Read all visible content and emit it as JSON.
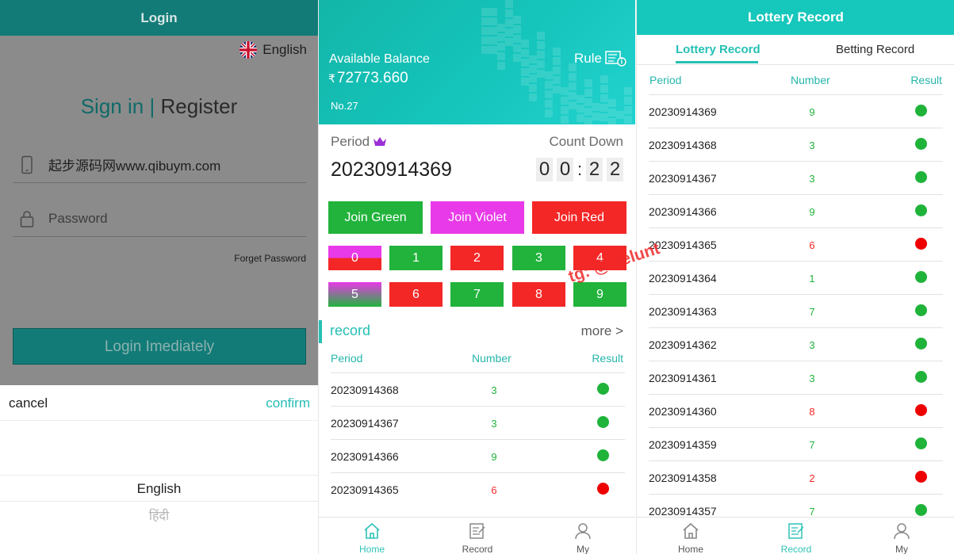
{
  "login": {
    "title": "Login",
    "language": "English",
    "sign_in": "Sign in",
    "separator": "|",
    "register": "Register",
    "phone_value": "起步源码网www.qibuym.com",
    "password_placeholder": "Password",
    "forget_password": "Forget Password",
    "login_button": "Login Imediately",
    "picker": {
      "cancel": "cancel",
      "confirm": "confirm",
      "options": [
        "English",
        "हिंदी"
      ]
    }
  },
  "home": {
    "balance_label": "Available Balance",
    "currency": "₹",
    "balance_value": "72773.660",
    "rule_label": "Rule",
    "banner_number": "No.27",
    "period_label": "Period",
    "countdown_label": "Count Down",
    "period_value": "20230914369",
    "countdown_digits": [
      "0",
      "0",
      "2",
      "2"
    ],
    "countdown_separator": ":",
    "join_buttons": [
      {
        "label": "Join Green",
        "color": "#21b33c"
      },
      {
        "label": "Join Violet",
        "color": "#e83ae8"
      },
      {
        "label": "Join Red",
        "color": "#f42727"
      }
    ],
    "numbers": [
      "0",
      "1",
      "2",
      "3",
      "4",
      "5",
      "6",
      "7",
      "8",
      "9"
    ],
    "record_title": "record",
    "more": "more >",
    "table_headers": [
      "Period",
      "Number",
      "Result"
    ],
    "records": [
      {
        "period": "20230914368",
        "number": "3",
        "result": "green"
      },
      {
        "period": "20230914367",
        "number": "3",
        "result": "green"
      },
      {
        "period": "20230914366",
        "number": "9",
        "result": "green"
      },
      {
        "period": "20230914365",
        "number": "6",
        "result": "red"
      }
    ]
  },
  "lottery": {
    "title": "Lottery Record",
    "tabs": [
      "Lottery Record",
      "Betting Record"
    ],
    "table_headers": [
      "Period",
      "Number",
      "Result"
    ],
    "records": [
      {
        "period": "20230914369",
        "number": "9",
        "result": "green"
      },
      {
        "period": "20230914368",
        "number": "3",
        "result": "green"
      },
      {
        "period": "20230914367",
        "number": "3",
        "result": "green"
      },
      {
        "period": "20230914366",
        "number": "9",
        "result": "green"
      },
      {
        "period": "20230914365",
        "number": "6",
        "result": "red"
      },
      {
        "period": "20230914364",
        "number": "1",
        "result": "green"
      },
      {
        "period": "20230914363",
        "number": "7",
        "result": "green"
      },
      {
        "period": "20230914362",
        "number": "3",
        "result": "green"
      },
      {
        "period": "20230914361",
        "number": "3",
        "result": "green"
      },
      {
        "period": "20230914360",
        "number": "8",
        "result": "red"
      },
      {
        "period": "20230914359",
        "number": "7",
        "result": "green"
      },
      {
        "period": "20230914358",
        "number": "2",
        "result": "red"
      },
      {
        "period": "20230914357",
        "number": "7",
        "result": "green"
      }
    ]
  },
  "nav": {
    "home": "Home",
    "record": "Record",
    "my": "My"
  },
  "watermark": "tg: @welunt",
  "colors": {
    "teal": "#16c7bb",
    "dark_teal": "#127b77",
    "green": "#21b33c",
    "red": "#f42727",
    "violet": "#e83ae8",
    "active_nav": "#2ec3b8",
    "inactive_nav": "#555555"
  }
}
